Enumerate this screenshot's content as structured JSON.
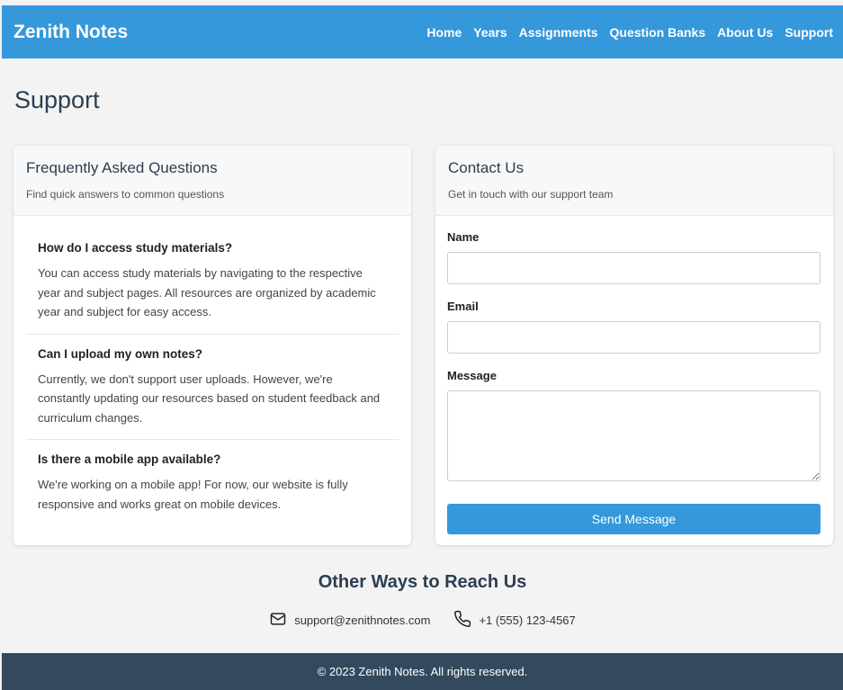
{
  "header": {
    "brand": "Zenith Notes",
    "nav": [
      "Home",
      "Years",
      "Assignments",
      "Question Banks",
      "About Us",
      "Support"
    ],
    "active": "Support"
  },
  "page": {
    "title": "Support"
  },
  "faq": {
    "title": "Frequently Asked Questions",
    "subtitle": "Find quick answers to common questions",
    "items": [
      {
        "question": "How do I access study materials?",
        "answer": "You can access study materials by navigating to the respective year and subject pages. All resources are organized by academic year and subject for easy access."
      },
      {
        "question": "Can I upload my own notes?",
        "answer": "Currently, we don't support user uploads. However, we're constantly updating our resources based on student feedback and curriculum changes."
      },
      {
        "question": "Is there a mobile app available?",
        "answer": "We're working on a mobile app! For now, our website is fully responsive and works great on mobile devices."
      }
    ]
  },
  "contact": {
    "title": "Contact Us",
    "subtitle": "Get in touch with our support team",
    "name_label": "Name",
    "name_value": "",
    "email_label": "Email",
    "email_value": "",
    "message_label": "Message",
    "message_value": "",
    "submit_label": "Send Message"
  },
  "other": {
    "title": "Other Ways to Reach Us",
    "email": "support@zenithnotes.com",
    "email_icon": "mail-icon",
    "phone": "+1 (555) 123-4567",
    "phone_icon": "phone-icon"
  },
  "footer": {
    "text": "© 2023 Zenith Notes. All rights reserved."
  },
  "colors": {
    "primary": "#3498db",
    "footer": "#34495e",
    "text": "#2c3e50"
  }
}
